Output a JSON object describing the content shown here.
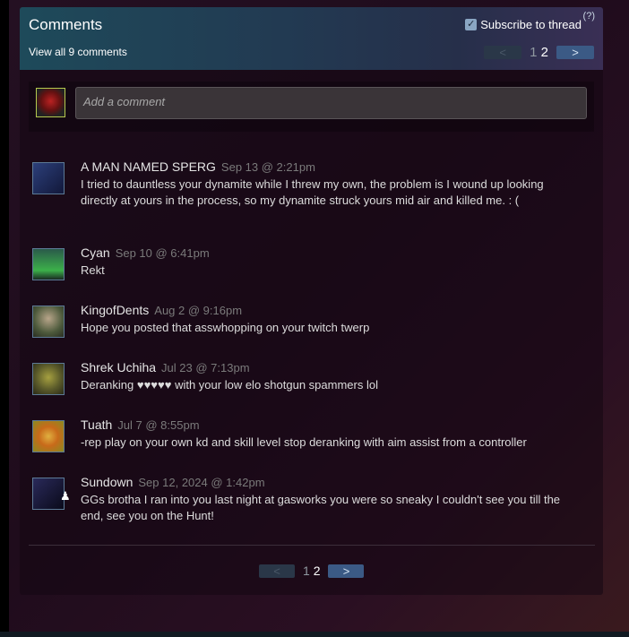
{
  "header": {
    "title": "Comments",
    "view_all": "View all 9 comments",
    "subscribe_label": "Subscribe to thread",
    "help": "(?)"
  },
  "pagination": {
    "prev": "<",
    "next": ">",
    "page1": "1",
    "page2": "2",
    "current_page": 2
  },
  "composer": {
    "placeholder": "Add a comment"
  },
  "comments": [
    {
      "author": "A MAN NAMED SPERG",
      "time": "Sep 13 @ 2:21pm",
      "text": "I tried to dauntless your dynamite while I threw my own, the problem is I wound up looking directly at yours in the process, so my dynamite struck yours mid air and killed me. : ("
    },
    {
      "author": "Cyan",
      "time": "Sep 10 @ 6:41pm",
      "text": "Rekt"
    },
    {
      "author": "KingofDents",
      "time": "Aug 2 @ 9:16pm",
      "text": "Hope you posted that asswhopping on your twitch twerp"
    },
    {
      "author": "Shrek Uchiha",
      "time": "Jul 23 @ 7:13pm",
      "text": "Deranking ♥♥♥♥♥ with your low elo shotgun spammers lol"
    },
    {
      "author": "Tuath",
      "time": "Jul 7 @ 8:55pm",
      "text": "-rep play on your own kd and skill level stop deranking with aim assist from a controller"
    },
    {
      "author": "Sundown",
      "time": "Sep 12, 2024 @ 1:42pm",
      "text": "GGs brotha I ran into you last night at gasworks you were so sneaky I couldn't see you till the end, see you on the Hunt!"
    }
  ],
  "colors": {
    "accent": "#3b5a85",
    "author_text": "#e5e5e5",
    "timestamp_text": "#7a7a7a"
  }
}
